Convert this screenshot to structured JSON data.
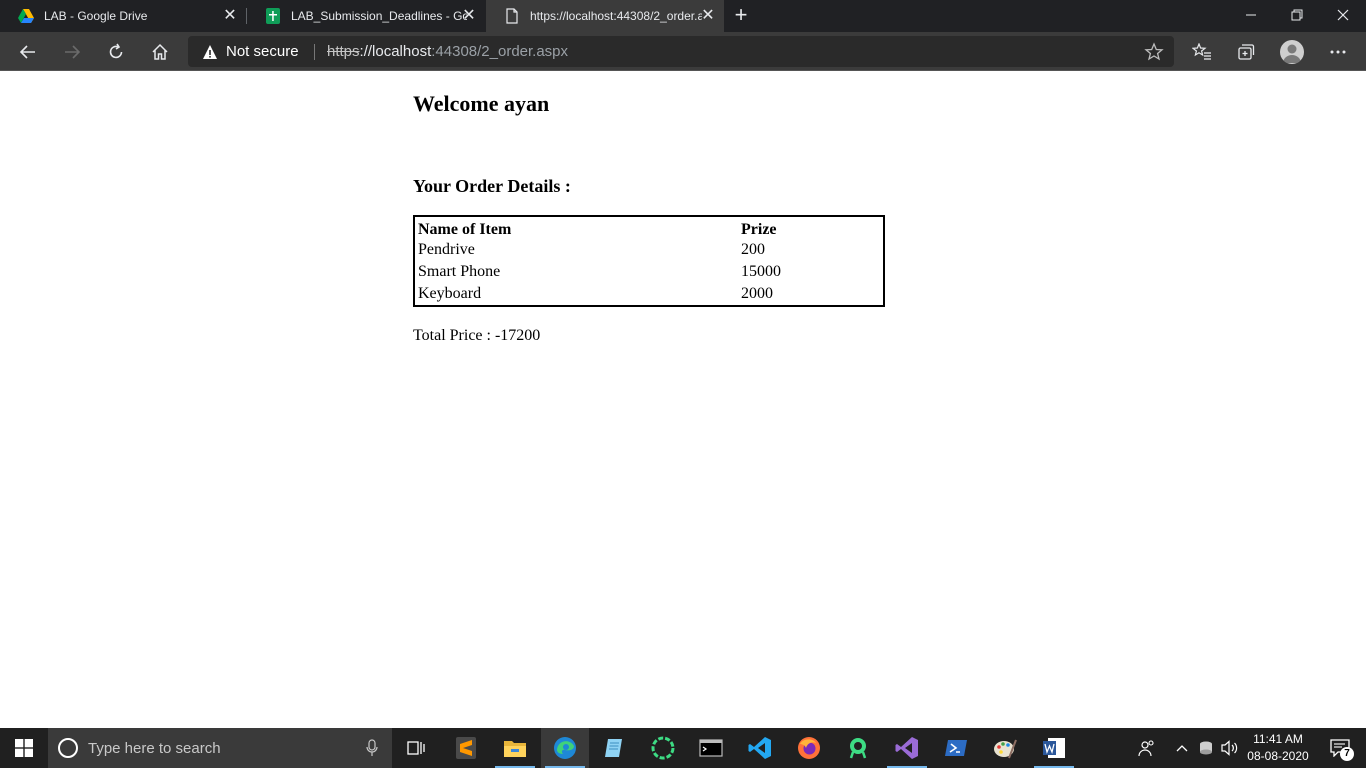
{
  "browser": {
    "tabs": [
      {
        "title": "LAB - Google Drive",
        "favicon": "google-drive-icon"
      },
      {
        "title": "LAB_Submission_Deadlines - Goo",
        "favicon": "google-sheets-icon"
      },
      {
        "title": "https://localhost:44308/2_order.a",
        "favicon": "page-icon"
      }
    ],
    "address": {
      "security_label": "Not secure",
      "scheme": "https",
      "host": "://localhost",
      "path": ":44308/2_order.aspx"
    }
  },
  "page": {
    "welcome": "Welcome ayan",
    "order_heading": "Your Order Details :",
    "table": {
      "headers": [
        "Name of Item",
        "Prize"
      ],
      "rows": [
        [
          "Pendrive",
          "200"
        ],
        [
          "Smart Phone",
          "15000"
        ],
        [
          "Keyboard",
          "2000"
        ]
      ]
    },
    "total": "Total Price : -17200"
  },
  "taskbar": {
    "search_placeholder": "Type here to search",
    "time": "11:41 AM",
    "date": "08-08-2020",
    "notification_count": "7",
    "apps": [
      "task-view-icon",
      "sublime-text-icon",
      "file-explorer-icon",
      "edge-icon",
      "notepad-icon",
      "android-studio-icon",
      "terminal-icon",
      "vscode-icon",
      "firefox-icon",
      "android-icon",
      "visual-studio-icon",
      "powershell-icon",
      "paint-icon",
      "word-icon"
    ]
  },
  "colors": {
    "tabstrip": "#202124",
    "toolbar": "#3b3b3b",
    "taskbar": "#202020",
    "accent": "#76b9ed"
  }
}
